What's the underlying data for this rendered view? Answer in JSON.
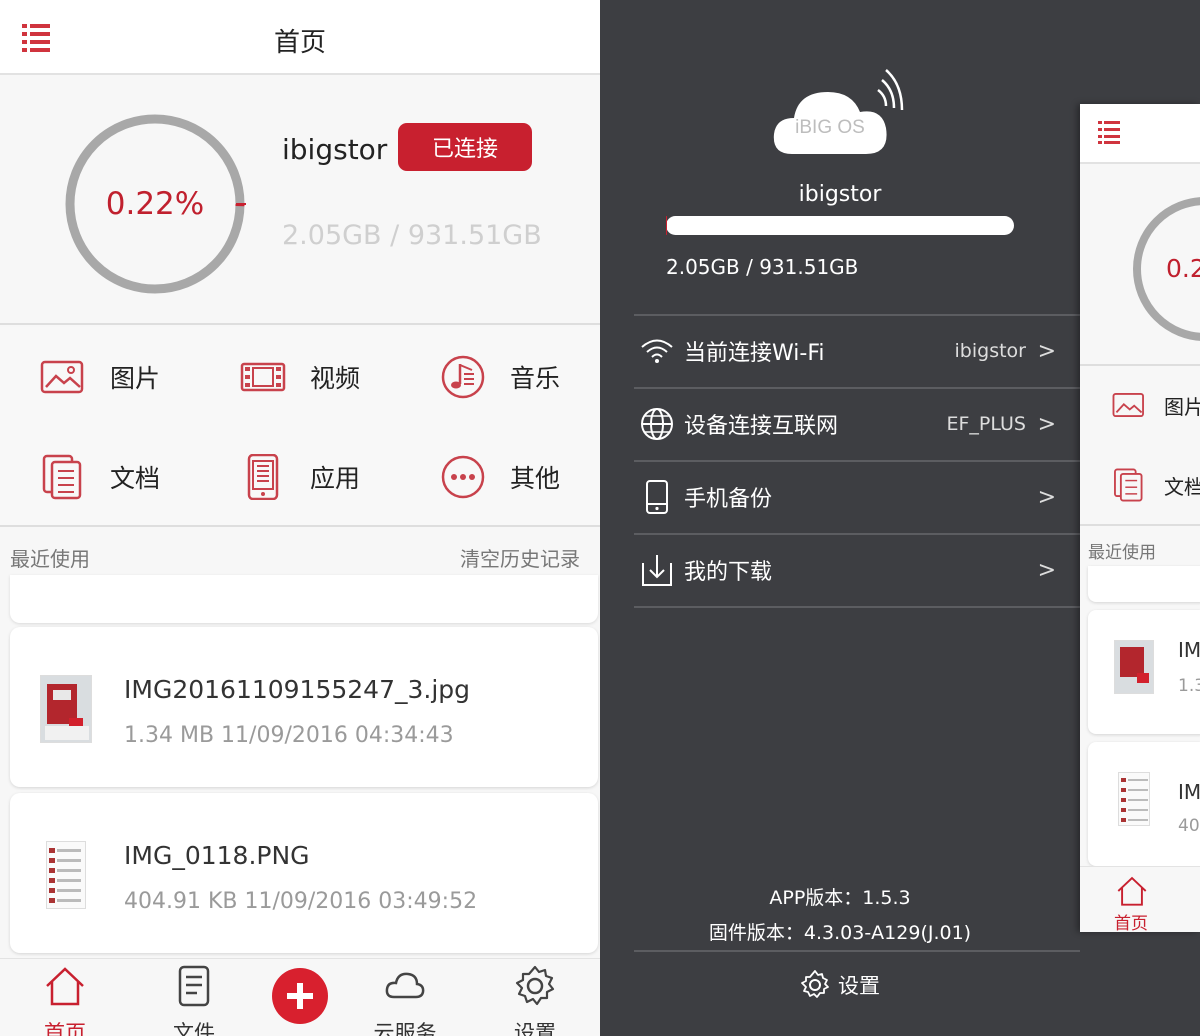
{
  "main": {
    "title": "首页",
    "device": {
      "name": "ibigstor",
      "status_label": "已连接",
      "usage_percent_label": "0.22%",
      "usage_fraction": 0.0022,
      "usage_text": "2.05GB / 931.51GB"
    },
    "categories": [
      {
        "label": "图片",
        "icon": "image-icon"
      },
      {
        "label": "视频",
        "icon": "video-icon"
      },
      {
        "label": "音乐",
        "icon": "music-icon"
      },
      {
        "label": "文档",
        "icon": "document-icon"
      },
      {
        "label": "应用",
        "icon": "phone-app-icon"
      },
      {
        "label": "其他",
        "icon": "more-icon"
      }
    ],
    "recent": {
      "title": "最近使用",
      "clear_label": "清空历史记录",
      "files": [
        {
          "name": "IMG20161109155247_3.jpg",
          "meta": "1.34 MB  11/09/2016 04:34:43"
        },
        {
          "name": "IMG_0118.PNG",
          "meta": "404.91 KB  11/09/2016 03:49:52"
        }
      ]
    },
    "tabs": [
      {
        "label": "首页",
        "icon": "home-icon",
        "active": true
      },
      {
        "label": "文件",
        "icon": "file-icon",
        "active": false
      },
      {
        "label": "云服务",
        "icon": "cloud-icon",
        "active": false
      },
      {
        "label": "设置",
        "icon": "gear-icon",
        "active": false
      }
    ],
    "accent_color": "#c8202f"
  },
  "drawer": {
    "logo_text": "iBIG OS",
    "device_name": "ibigstor",
    "usage_text": "2.05GB / 931.51GB",
    "usage_fraction": 0.0022,
    "menu": [
      {
        "label": "当前连接Wi-Fi",
        "value": "ibigstor",
        "icon": "wifi-icon"
      },
      {
        "label": "设备连接互联网",
        "value": "EF_PLUS",
        "icon": "globe-icon"
      },
      {
        "label": "手机备份",
        "value": "",
        "icon": "phone-icon"
      },
      {
        "label": "我的下载",
        "value": "",
        "icon": "download-icon"
      }
    ],
    "chevron": ">",
    "app_version": "APP版本：1.5.3",
    "firmware_version": "固件版本：4.3.03-A129(J.01)",
    "settings_label": "设置",
    "background_color": "#3d3e42"
  },
  "peek": {
    "percent_fragment": "0.2",
    "cat_labels": [
      "图片",
      "文档"
    ],
    "recent_title": "最近使用",
    "file_name_fragment": "IM",
    "file_meta_fragments": [
      "1.3",
      "40"
    ],
    "tab_label": "首页"
  }
}
